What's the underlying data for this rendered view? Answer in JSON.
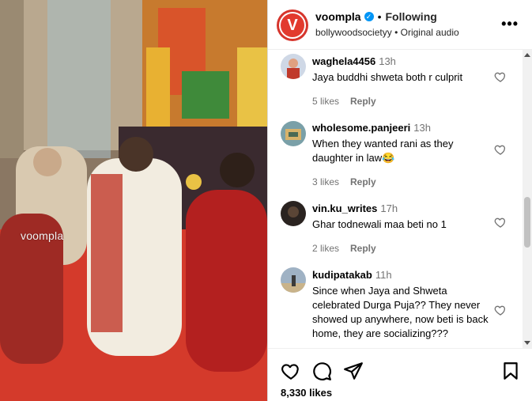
{
  "post": {
    "watermark": "voompla"
  },
  "header": {
    "avatar_letter": "V",
    "username": "voompla",
    "separator": "•",
    "follow_status": "Following",
    "audio_user": "bollywoodsocietyy",
    "audio_separator": "•",
    "audio_label": "Original audio",
    "more_label": "•••"
  },
  "comments": [
    {
      "username": "waghela4456",
      "time": "13h",
      "text": "Jaya buddhi shweta both r culprit",
      "likes": "5 likes",
      "reply": "Reply"
    },
    {
      "username": "wholesome.panjeeri",
      "time": "13h",
      "text": "When they wanted rani as they daughter in law😂",
      "likes": "3 likes",
      "reply": "Reply"
    },
    {
      "username": "vin.ku_writes",
      "time": "17h",
      "text": "Ghar todnewali maa beti no 1",
      "likes": "2 likes",
      "reply": "Reply"
    },
    {
      "username": "kudipatakab",
      "time": "11h",
      "text": "Since when Jaya and Shweta celebrated Durga Puja?? They never showed up anywhere, now beti is back home, they are socializing???",
      "likes": "",
      "reply": ""
    }
  ],
  "actions": {
    "icons": [
      "heart-icon",
      "comment-icon",
      "share-icon",
      "bookmark-icon"
    ],
    "likes_count": "8,330 likes"
  },
  "colors": {
    "accent": "#0095f6",
    "brand": "#e23a2e",
    "muted": "#737373"
  }
}
